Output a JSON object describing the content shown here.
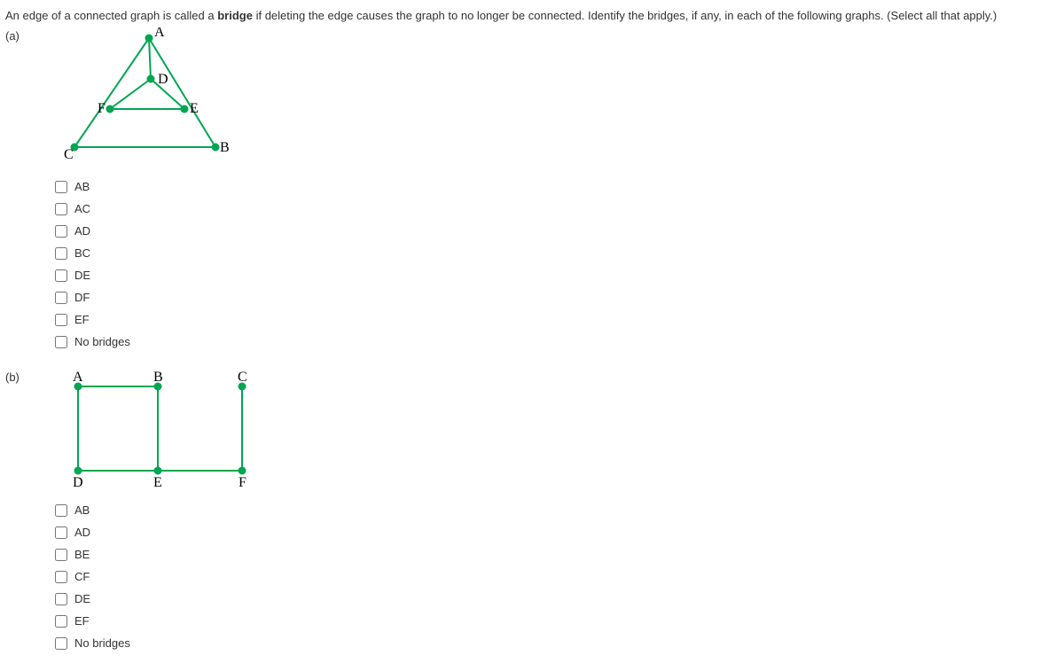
{
  "intro": {
    "pre": "An edge of a connected graph is called a ",
    "bold": "bridge",
    "post": " if deleting the edge causes the graph to no longer be connected. Identify the bridges, if any, in each of the following graphs. (Select all that apply.)"
  },
  "parts": {
    "a": {
      "label": "(a)",
      "options": [
        "AB",
        "AC",
        "AD",
        "BC",
        "DE",
        "DF",
        "EF",
        "No bridges"
      ]
    },
    "b": {
      "label": "(b)",
      "options": [
        "AB",
        "AD",
        "BE",
        "CF",
        "DE",
        "EF",
        "No bridges"
      ]
    }
  },
  "chart_data": [
    {
      "type": "graph",
      "part": "a",
      "nodes": [
        {
          "id": "A",
          "label_pos": "top"
        },
        {
          "id": "B",
          "label_pos": "right"
        },
        {
          "id": "C",
          "label_pos": "left"
        },
        {
          "id": "D",
          "label_pos": "right"
        },
        {
          "id": "E",
          "label_pos": "right"
        },
        {
          "id": "F",
          "label_pos": "left"
        }
      ],
      "edges": [
        "AB",
        "AC",
        "AD",
        "BC",
        "DE",
        "DF",
        "EF"
      ]
    },
    {
      "type": "graph",
      "part": "b",
      "nodes": [
        {
          "id": "A",
          "label_pos": "top"
        },
        {
          "id": "B",
          "label_pos": "top"
        },
        {
          "id": "C",
          "label_pos": "top"
        },
        {
          "id": "D",
          "label_pos": "bottom"
        },
        {
          "id": "E",
          "label_pos": "bottom"
        },
        {
          "id": "F",
          "label_pos": "bottom"
        }
      ],
      "edges": [
        "AB",
        "AD",
        "BE",
        "CF",
        "DE",
        "EF"
      ]
    }
  ]
}
